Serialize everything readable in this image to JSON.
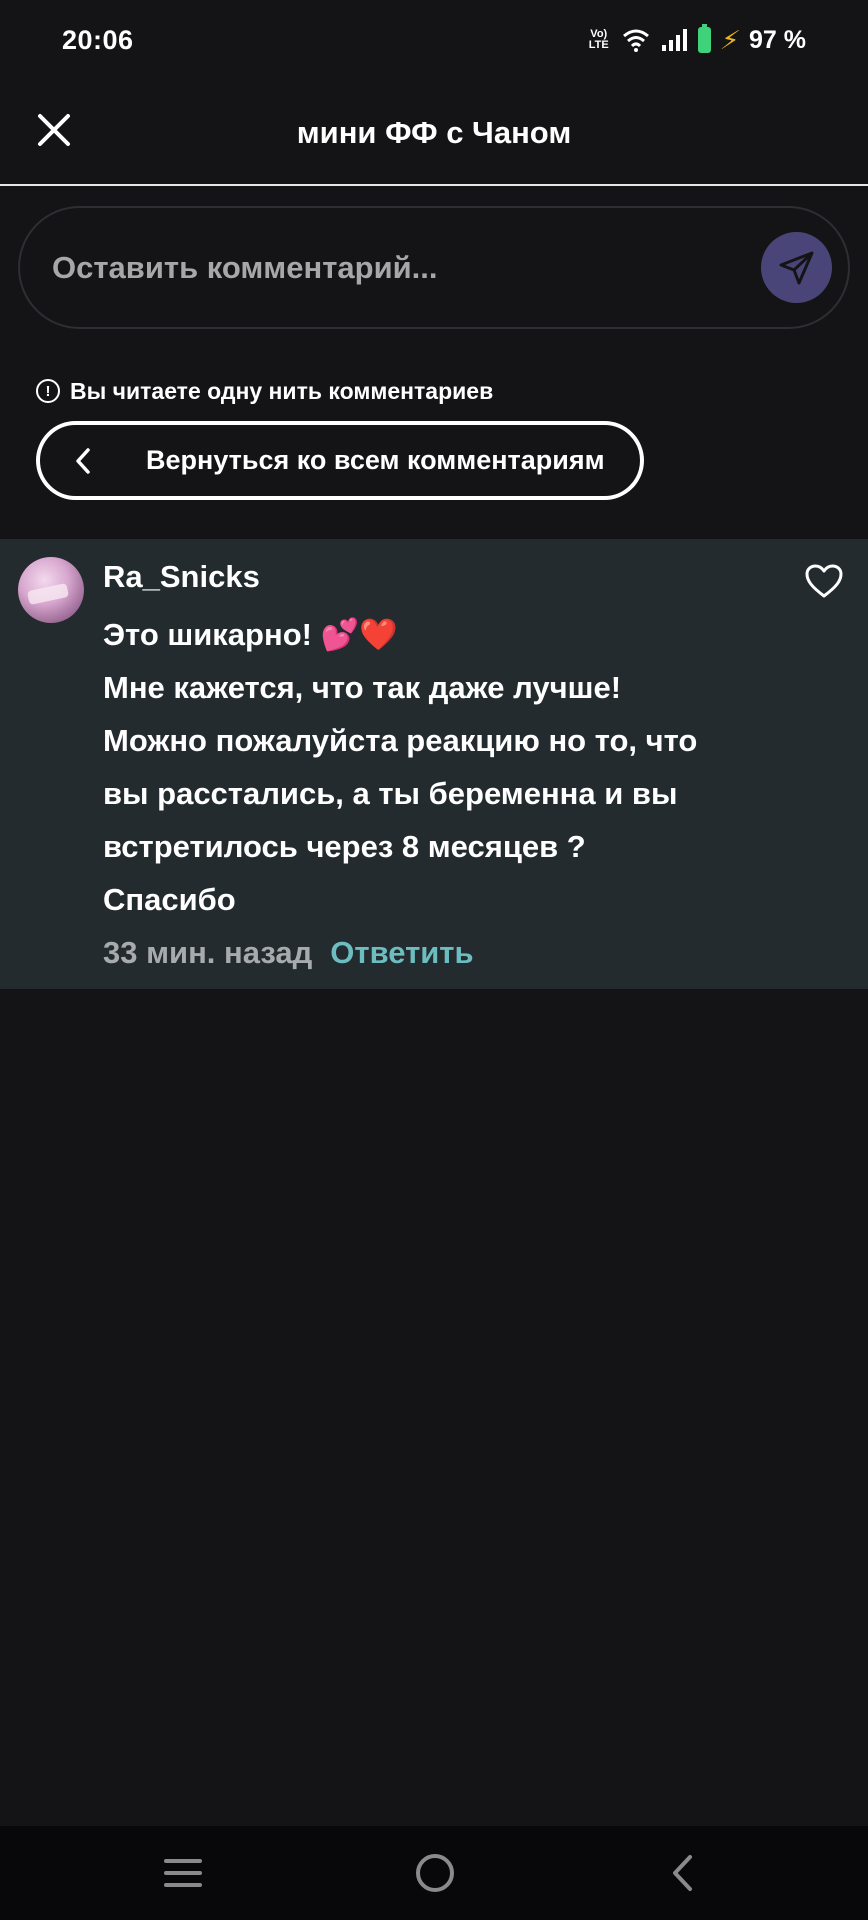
{
  "status_bar": {
    "time": "20:06",
    "volte_label": "Vo) LTE",
    "battery_percent": "97 %",
    "colors": {
      "battery": "#3fd27a",
      "charging_bolt": "#e8b51e"
    },
    "icons": [
      "volte-icon",
      "wifi-icon",
      "signal-icon",
      "battery-icon",
      "charging-icon"
    ]
  },
  "header": {
    "title": "мини ФФ с Чаном",
    "close_icon": "close-icon"
  },
  "composer": {
    "placeholder": "Оставить комментарий...",
    "send_icon": "send-icon",
    "send_color": "#4a4578"
  },
  "thread": {
    "notice": "Вы читаете одну нить комментариев",
    "back_label": "Вернуться ко всем комментариям"
  },
  "comment": {
    "username": "Ra_Snicks",
    "lines": [
      "Это шикарно! 💕❤️",
      "Мне кажется, что так даже лучше!",
      "Можно пожалуйста реакцию но то, что",
      "вы расстались, а ты беременна и вы",
      "встретилось через 8 месяцев ?",
      "Спасибо"
    ],
    "time_ago": "33 мин. назад",
    "reply_label": "Ответить",
    "reply_color": "#6cbdbf",
    "background": "#232b2f"
  },
  "nav_bar": {
    "icons": [
      "menu-icon",
      "home-icon",
      "back-icon"
    ]
  }
}
